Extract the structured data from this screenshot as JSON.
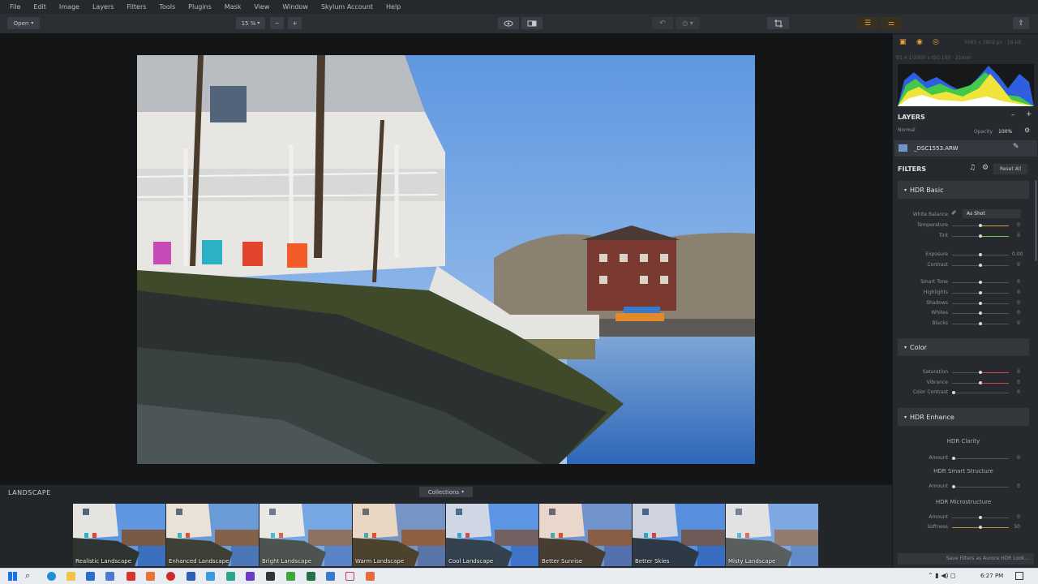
{
  "menu": [
    "File",
    "Edit",
    "Image",
    "Layers",
    "Filters",
    "Tools",
    "Plugins",
    "Mask",
    "View",
    "Window",
    "Skylum Account",
    "Help"
  ],
  "toolbar": {
    "open_label": "Open",
    "zoom_label": "15 %",
    "zoom_out": "−",
    "zoom_in": "+"
  },
  "panel": {
    "image_info": "5565 x 3902 px · 16-bit",
    "camera_info": "f/1.4 1/2000 s ISO 100 · 21mm",
    "layers_title": "LAYERS",
    "blend_mode": "Normal",
    "opacity_label": "Opacity",
    "opacity_value": "100%",
    "layer_name": "_DSC1553.ARW",
    "filters_title": "FILTERS",
    "reset_all": "Reset All",
    "hdr_basic": "HDR Basic",
    "white_balance_label": "White Balance",
    "white_balance_value": "As Shot",
    "basic_sliders": [
      {
        "label": "Temperature",
        "value": "0",
        "pos": 0.5,
        "color": "#c7a93a"
      },
      {
        "label": "Tint",
        "value": "0",
        "pos": 0.5,
        "color": "#7fc04a"
      },
      {
        "label": "Exposure",
        "value": "0.00",
        "pos": 0.5,
        "color": ""
      },
      {
        "label": "Contrast",
        "value": "0",
        "pos": 0.5,
        "color": ""
      },
      {
        "label": "Smart Tone",
        "value": "0",
        "pos": 0.5,
        "color": ""
      },
      {
        "label": "Highlights",
        "value": "0",
        "pos": 0.5,
        "color": ""
      },
      {
        "label": "Shadows",
        "value": "0",
        "pos": 0.5,
        "color": ""
      },
      {
        "label": "Whites",
        "value": "0",
        "pos": 0.5,
        "color": ""
      },
      {
        "label": "Blacks",
        "value": "0",
        "pos": 0.5,
        "color": ""
      }
    ],
    "color_section": "Color",
    "color_sliders": [
      {
        "label": "Saturation",
        "value": "0",
        "pos": 0.5,
        "color": "#d04848"
      },
      {
        "label": "Vibrance",
        "value": "0",
        "pos": 0.5,
        "color": "#d04848"
      },
      {
        "label": "Color Contrast",
        "value": "0",
        "pos": 0.0,
        "color": ""
      }
    ],
    "hdr_enhance": "HDR Enhance",
    "hdr_clarity": "HDR Clarity",
    "hdr_smart_structure": "HDR Smart Structure",
    "hdr_microstructure": "HDR Microstructure",
    "amount": "Amount",
    "softness": "Softness",
    "amount_value": "0",
    "softness_value": "50",
    "save_filters": "Save Filters as Aurora HDR Look..."
  },
  "strip": {
    "title": "LANDSCAPE",
    "collections": "Collections",
    "presets": [
      "Realistic Landscape",
      "Enhanced Landscape",
      "Bright Landscape",
      "Warm Landscape",
      "Cool Landscape",
      "Better Sunrise",
      "Better Skies",
      "Misty Landscape"
    ]
  },
  "taskbar": {
    "time": "6:27 PM"
  },
  "colors": {
    "accent": "#e8a33a",
    "panel": "#26292d",
    "canvas": "#141517"
  }
}
